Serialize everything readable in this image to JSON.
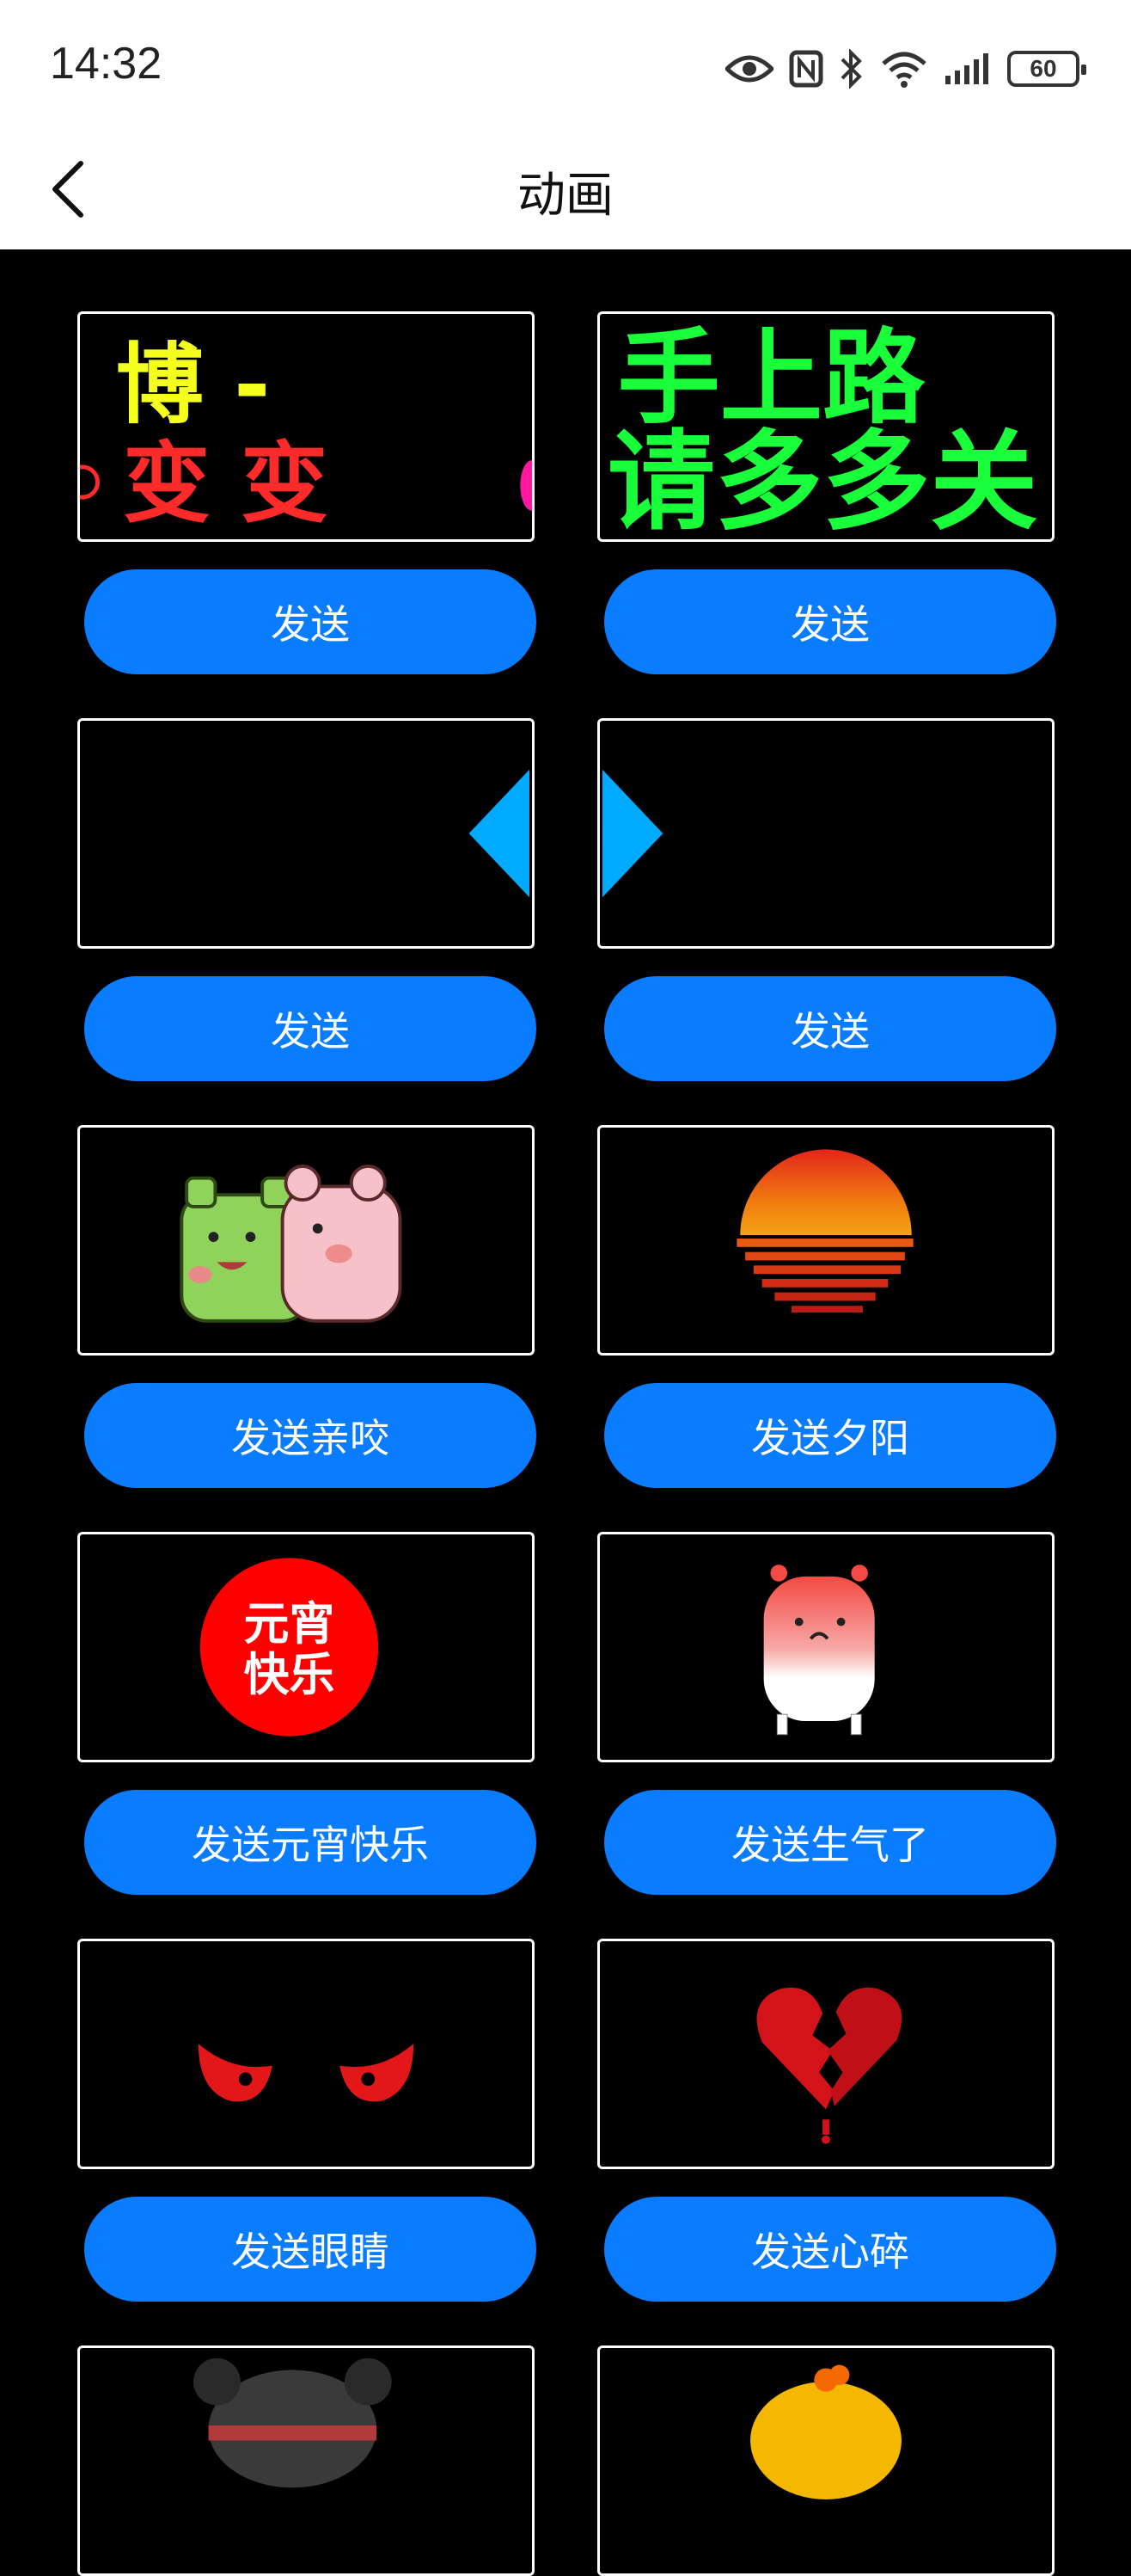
{
  "status": {
    "time": "14:32",
    "battery": "60"
  },
  "header": {
    "title": "动画"
  },
  "items": [
    {
      "preview": {
        "line1": "博  -",
        "line2": "变  变"
      },
      "button": "发送"
    },
    {
      "preview": {
        "line1": "手上路",
        "line2": "请多多关"
      },
      "button": "发送"
    },
    {
      "preview": {},
      "button": "发送"
    },
    {
      "preview": {},
      "button": "发送"
    },
    {
      "preview": {},
      "button": "发送亲咬"
    },
    {
      "preview": {},
      "button": "发送夕阳"
    },
    {
      "preview": {
        "badge_top": "元宵",
        "badge_bottom": "快乐"
      },
      "button": "发送元宵快乐"
    },
    {
      "preview": {},
      "button": "发送生气了"
    },
    {
      "preview": {},
      "button": "发送眼睛"
    },
    {
      "preview": {},
      "button": "发送心碎"
    }
  ],
  "colors": {
    "accent": "#0a7cff",
    "led_yellow": "#f5ff1e",
    "led_red": "#ff2a2a",
    "led_green": "#19ff3a",
    "arrow_blue": "#00aaff"
  }
}
